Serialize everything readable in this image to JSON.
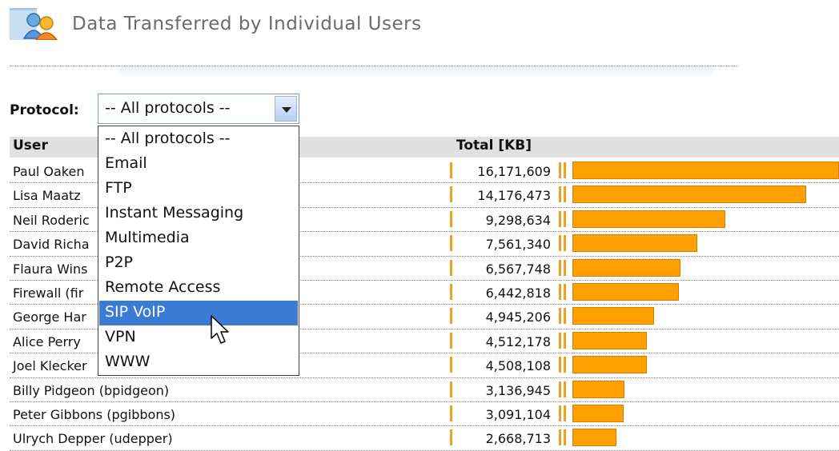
{
  "header": {
    "title": "Data Transferred by Individual Users"
  },
  "filter": {
    "label": "Protocol:",
    "selected": "-- All protocols --",
    "options": [
      "-- All protocols --",
      "Email",
      "FTP",
      "Instant Messaging",
      "Multimedia",
      "P2P",
      "Remote Access",
      "SIP VoIP",
      "VPN",
      "WWW"
    ],
    "highlighted_index": 7
  },
  "table": {
    "columns": [
      "User",
      "Total [KB]"
    ],
    "rows": [
      {
        "user": "Paul Oaken",
        "total": "16,171,609",
        "value": 16171609
      },
      {
        "user": "Lisa Maatz",
        "total": "14,176,473",
        "value": 14176473
      },
      {
        "user": "Neil Roderic",
        "total": "9,298,634",
        "value": 9298634
      },
      {
        "user": "David Richa",
        "total": "7,561,340",
        "value": 7561340
      },
      {
        "user": "Flaura Wins",
        "total": "6,567,748",
        "value": 6567748
      },
      {
        "user": "Firewall (fir",
        "total": "6,442,818",
        "value": 6442818
      },
      {
        "user": "George Har",
        "total": "4,945,206",
        "value": 4945206
      },
      {
        "user": "Alice Perry",
        "total": "4,512,178",
        "value": 4512178
      },
      {
        "user": "Joel Klecker",
        "total": "4,508,108",
        "value": 4508108
      },
      {
        "user": "Billy Pidgeon (bpidgeon)",
        "total": "3,136,945",
        "value": 3136945
      },
      {
        "user": "Peter Gibbons (pgibbons)",
        "total": "3,091,104",
        "value": 3091104
      },
      {
        "user": "Ulrych Depper (udepper)",
        "total": "2,668,713",
        "value": 2668713
      }
    ]
  },
  "colors": {
    "bar": "#ffa000",
    "highlight": "#3a7bd5"
  },
  "icons": {
    "header": "users-icon",
    "cursor": "mouse-pointer-icon"
  }
}
